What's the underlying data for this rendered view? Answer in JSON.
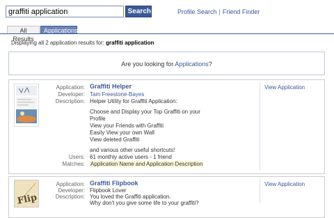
{
  "search": {
    "query": "graffiti application",
    "button_label": "Search",
    "links": [
      "Profile Search",
      "Friend Finder"
    ],
    "link_separator": "|"
  },
  "tabs": [
    {
      "label": "All Results",
      "active": false
    },
    {
      "label": "Applications",
      "active": true
    }
  ],
  "summary": {
    "prefix": "Displaying all 2 application results for:",
    "query": "graffiti application"
  },
  "looking_for": {
    "prefix": "Are you looking for",
    "link": "Applications",
    "suffix": "?"
  },
  "labels": {
    "application": "Application:",
    "developer": "Developer:",
    "description": "Description:",
    "users": "Users:",
    "matches": "Matches:"
  },
  "results": [
    {
      "name": "Graffiti Helper",
      "developer": "Tam Freestone-Bayes",
      "description_lines": [
        "Helper Utility for Graffiti Application:",
        "",
        "Choose and Display your Top Graffiti on your",
        "Profile",
        "View your Friends with Graffiti",
        "Easily View your own Wall",
        "View deleted Graffiti",
        "",
        "and various other useful shortcuts!"
      ],
      "users": "61 monthly active users - 1 friend",
      "matches": "Application Name and Application Description",
      "action": "View Application"
    },
    {
      "name": "Graffiti Flipbook",
      "developer": "Flipbook Lover",
      "description_lines": [
        "You loved the Graffiti application.",
        "Why don't you give some life to your graffiti?"
      ],
      "action": "View Application",
      "thumb_text": "Flip"
    }
  ],
  "colors": {
    "brand": "#3b5998",
    "tab_active": "#6d84b4",
    "highlight": "#fff9d7"
  }
}
